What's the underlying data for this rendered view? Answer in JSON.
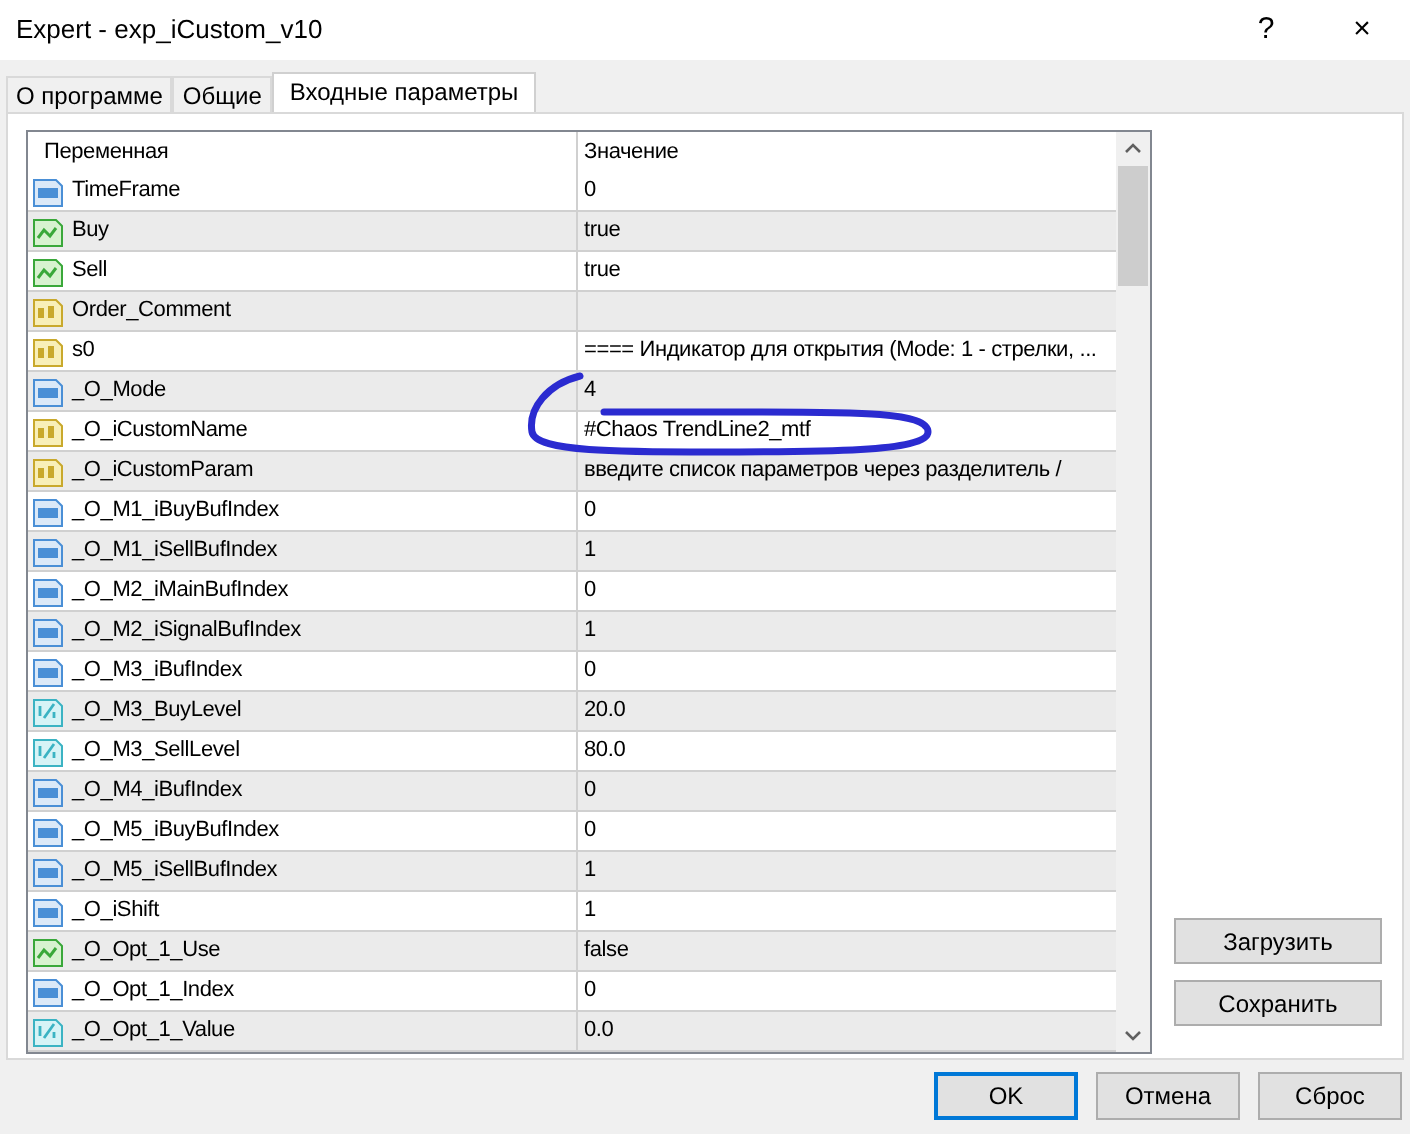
{
  "window": {
    "title": "Expert - exp_iCustom_v10",
    "help": "?",
    "close": "×"
  },
  "tabs": [
    {
      "label": "О программе",
      "selected": false
    },
    {
      "label": "Общие",
      "selected": false
    },
    {
      "label": "Входные параметры",
      "selected": true
    }
  ],
  "table": {
    "columns": [
      "Переменная",
      "Значение"
    ],
    "rows": [
      {
        "kind": "int",
        "name": "TimeFrame",
        "value": "0"
      },
      {
        "kind": "bool",
        "name": "Buy",
        "value": "true"
      },
      {
        "kind": "bool",
        "name": "Sell",
        "value": "true"
      },
      {
        "kind": "string",
        "name": "Order_Comment"
      },
      {
        "kind": "string",
        "name": "s0",
        "value": "==== Индикатор для открытия (Mode: 1 - стрелки, ..."
      },
      {
        "kind": "int",
        "name": "_O_Mode",
        "value": "4"
      },
      {
        "kind": "string",
        "name": "_O_iCustomName",
        "value": "#Chaos TrendLine2_mtf",
        "circled": true
      },
      {
        "kind": "string",
        "name": "_O_iCustomParam",
        "value": "введите список параметров через разделитель /"
      },
      {
        "kind": "int",
        "name": "_O_M1_iBuyBufIndex",
        "value": "0"
      },
      {
        "kind": "int",
        "name": "_O_M1_iSellBufIndex",
        "value": "1"
      },
      {
        "kind": "int",
        "name": "_O_M2_iMainBufIndex",
        "value": "0"
      },
      {
        "kind": "int",
        "name": "_O_M2_iSignalBufIndex",
        "value": "1"
      },
      {
        "kind": "int",
        "name": "_O_M3_iBufIndex",
        "value": "0"
      },
      {
        "kind": "double",
        "name": "_O_M3_BuyLevel",
        "value": "20.0"
      },
      {
        "kind": "double",
        "name": "_O_M3_SellLevel",
        "value": "80.0"
      },
      {
        "kind": "int",
        "name": "_O_M4_iBufIndex",
        "value": "0"
      },
      {
        "kind": "int",
        "name": "_O_M5_iBuyBufIndex",
        "value": "0"
      },
      {
        "kind": "int",
        "name": "_O_M5_iSellBufIndex",
        "value": "1"
      },
      {
        "kind": "int",
        "name": "_O_iShift",
        "value": "1"
      },
      {
        "kind": "bool",
        "name": "_O_Opt_1_Use",
        "value": "false"
      },
      {
        "kind": "int",
        "name": "_O_Opt_1_Index",
        "value": "0"
      },
      {
        "kind": "double",
        "name": "_O_Opt_1_Value",
        "value": "0.0"
      }
    ]
  },
  "side_buttons": [
    "Загрузить",
    "Сохранить"
  ],
  "buttons": [
    {
      "label": "OK",
      "default": true
    },
    {
      "label": "Отмена",
      "default": false
    },
    {
      "label": "Сброс",
      "default": false
    }
  ]
}
